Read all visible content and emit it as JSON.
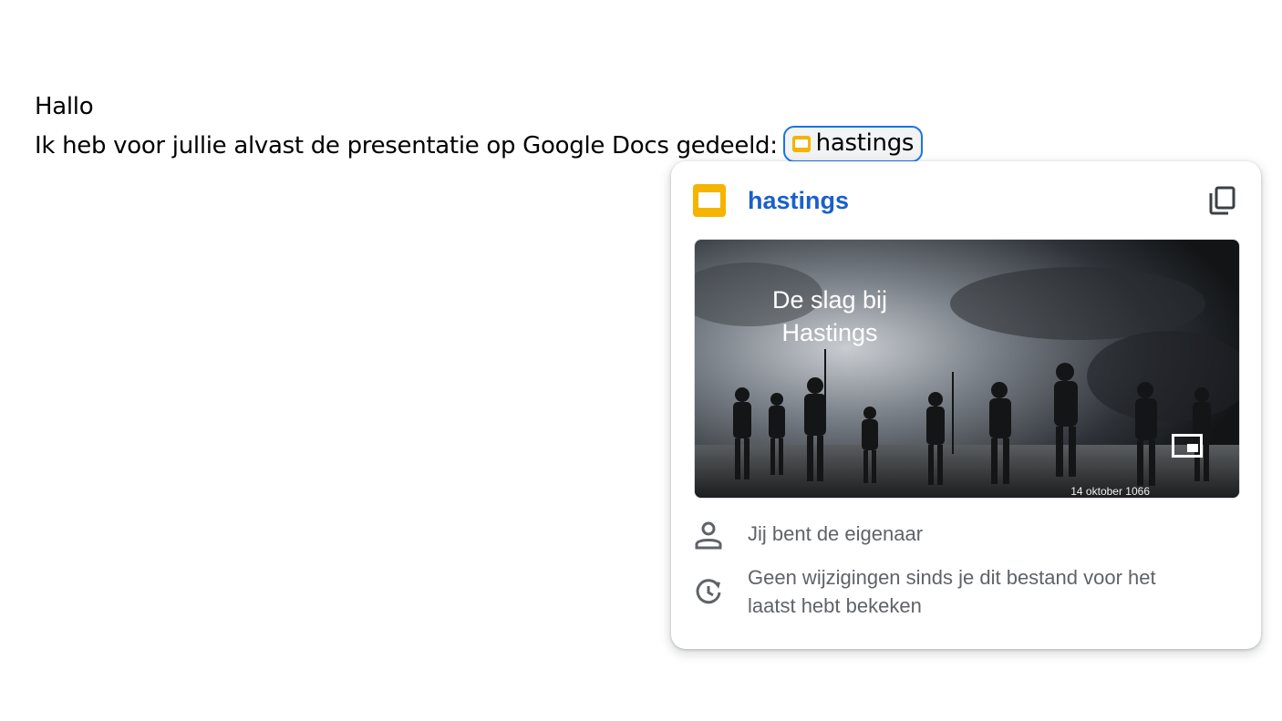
{
  "document": {
    "line1": "Hallo",
    "line2_text": "Ik heb voor jullie alvast de presentatie op Google Docs gedeeld:",
    "chip": {
      "label": "hastings",
      "icon": "google-slides-icon"
    }
  },
  "hovercard": {
    "title": "hastings",
    "file_icon": "google-slides-icon",
    "copy_icon": "copy-icon",
    "thumbnail": {
      "slide_title": "De slag bij Hastings",
      "slide_date": "14 oktober 1066",
      "overlay_icon": "picture-in-picture-icon"
    },
    "owner": {
      "icon": "person-icon",
      "text": "Jij bent de eigenaar"
    },
    "activity": {
      "icon": "history-clock-icon",
      "text": "Geen wijzigingen sinds je dit bestand voor het laatst hebt bekeken"
    }
  },
  "colors": {
    "link_blue": "#1a5fcc",
    "chip_border": "#1a73e8",
    "slides_yellow": "#f4b400",
    "secondary_text": "#5f6368"
  }
}
